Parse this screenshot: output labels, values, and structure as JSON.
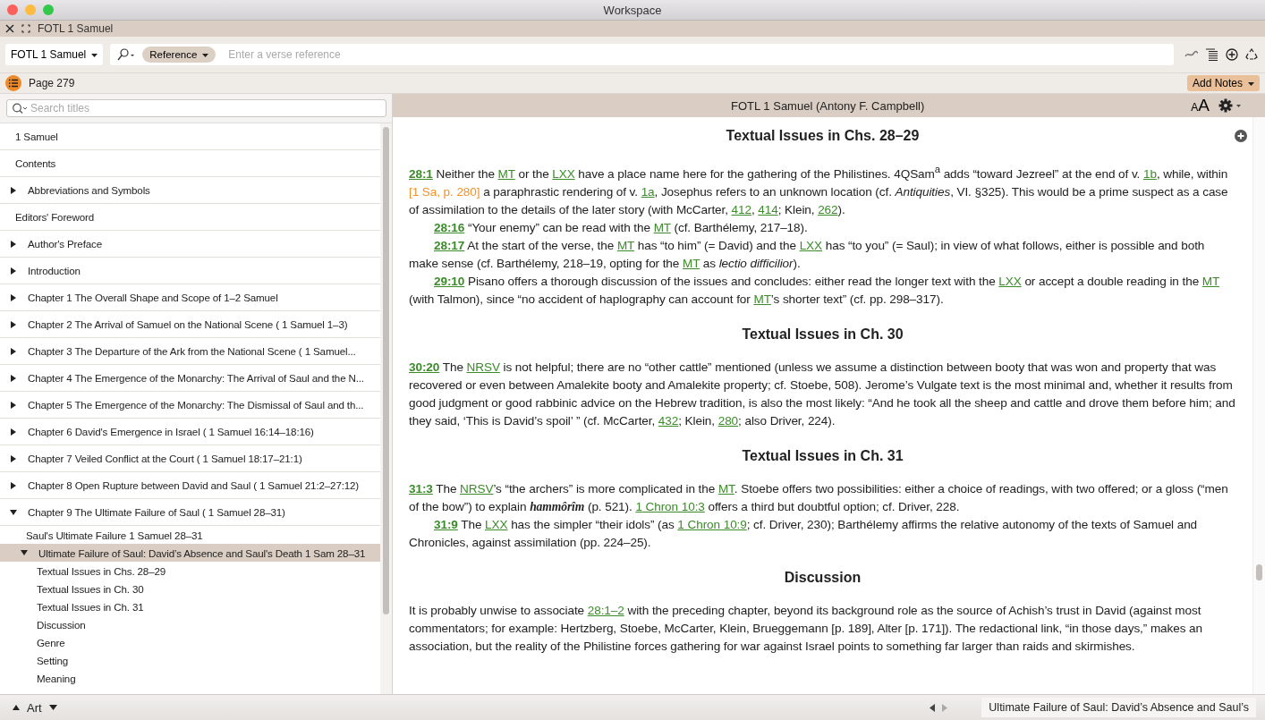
{
  "window": {
    "title": "Workspace"
  },
  "tab": {
    "title": "FOTL 1 Samuel"
  },
  "toolbar": {
    "resource": "FOTL 1 Samuel",
    "search_type": "Reference",
    "placeholder": "Enter a verse reference"
  },
  "page_bar": {
    "page": "Page 279",
    "add_notes": "Add Notes"
  },
  "sidebar": {
    "search_placeholder": "Search titles",
    "items": [
      {
        "title": "1 Samuel",
        "kind": "leaf",
        "selected": false
      },
      {
        "title": "Contents",
        "kind": "leaf",
        "selected": false
      },
      {
        "title": "Abbreviations and Symbols",
        "kind": "branch",
        "expanded": false,
        "selected": false
      },
      {
        "title": "Editors' Foreword",
        "kind": "leaf",
        "selected": false
      },
      {
        "title": "Author's Preface",
        "kind": "branch",
        "expanded": false,
        "selected": false
      },
      {
        "title": "Introduction",
        "kind": "branch",
        "expanded": false,
        "selected": false
      },
      {
        "title": "Chapter 1 The Overall Shape and Scope of 1–2 Samuel",
        "kind": "branch",
        "expanded": false,
        "selected": false
      },
      {
        "title": "Chapter 2 The Arrival of Samuel on the National Scene ( 1 Samuel 1–3)",
        "kind": "branch",
        "expanded": false,
        "selected": false
      },
      {
        "title": "Chapter 3 The Departure of the Ark from the National Scene ( 1 Samuel...",
        "kind": "branch",
        "expanded": false,
        "selected": false
      },
      {
        "title": "Chapter 4 The Emergence of the Monarchy: The Arrival of Saul and the N...",
        "kind": "branch",
        "expanded": false,
        "selected": false
      },
      {
        "title": "Chapter 5 The Emergence of the Monarchy: The Dismissal of Saul and th...",
        "kind": "branch",
        "expanded": false,
        "selected": false
      },
      {
        "title": "Chapter 6 David's Emergence in Israel ( 1 Samuel 16:14–18:16)",
        "kind": "branch",
        "expanded": false,
        "selected": false
      },
      {
        "title": "Chapter 7 Veiled Conflict at the Court ( 1 Samuel 18:17–21:1)",
        "kind": "branch",
        "expanded": false,
        "selected": false
      },
      {
        "title": "Chapter 8 Open Rupture between David and Saul ( 1 Samuel 21:2–27:12)",
        "kind": "branch",
        "expanded": false,
        "selected": false
      },
      {
        "title": "Chapter 9 The Ultimate Failure of Saul ( 1 Samuel 28–31)",
        "kind": "branch",
        "expanded": true,
        "selected": false,
        "children": [
          {
            "title": "Saul's Ultimate Failure 1 Samuel 28–31",
            "kind": "leaf",
            "selected": false
          },
          {
            "title": "Ultimate Failure of Saul: David’s Absence and Saul's Death 1 Sam 28–31",
            "kind": "branch",
            "expanded": true,
            "selected": true,
            "children": [
              {
                "title": "Textual Issues in Chs. 28–29",
                "kind": "leaf",
                "selected": false
              },
              {
                "title": "Textual Issues in Ch. 30",
                "kind": "leaf",
                "selected": false
              },
              {
                "title": "Textual Issues in Ch. 31",
                "kind": "leaf",
                "selected": false
              },
              {
                "title": "Discussion",
                "kind": "leaf",
                "selected": false
              },
              {
                "title": "Genre",
                "kind": "leaf",
                "selected": false
              },
              {
                "title": "Setting",
                "kind": "leaf",
                "selected": false
              },
              {
                "title": "Meaning",
                "kind": "leaf",
                "selected": false
              }
            ]
          }
        ]
      }
    ]
  },
  "reader": {
    "title": "FOTL 1 Samuel (Antony F. Campbell)",
    "font_button": "AA",
    "sections": [
      {
        "heading": "Textual Issues in Chs. 28–29",
        "paragraphs": [
          {
            "indent": false,
            "segments": [
              {
                "kind": "verse",
                "text": "28:1"
              },
              {
                "kind": "text",
                "text": " Neither the "
              },
              {
                "kind": "link",
                "text": "MT"
              },
              {
                "kind": "text",
                "text": " or the "
              },
              {
                "kind": "link",
                "text": "LXX"
              },
              {
                "kind": "text",
                "text": " have a place name here for the gathering of the Philistines. 4QSam$^{a}$ adds “toward Jezreel” at the end of v. "
              },
              {
                "kind": "link",
                "text": "1b"
              },
              {
                "kind": "text",
                "text": ", while, within "
              },
              {
                "kind": "cite",
                "text": "[1 Sa, p. 280]"
              },
              {
                "kind": "text",
                "text": " a paraphrastic rendering of v. "
              },
              {
                "kind": "link",
                "text": "1a"
              },
              {
                "kind": "text",
                "text": ", Josephus refers to an unknown location (cf. *Antiquities*, VI. §325). This would be a prime suspect as a case of assimilation to the details of the later story (with McCarter, "
              },
              {
                "kind": "link",
                "text": "412"
              },
              {
                "kind": "text",
                "text": ", "
              },
              {
                "kind": "link",
                "text": "414"
              },
              {
                "kind": "text",
                "text": "; Klein, "
              },
              {
                "kind": "link",
                "text": "262"
              },
              {
                "kind": "text",
                "text": ")."
              }
            ]
          },
          {
            "indent": true,
            "segments": [
              {
                "kind": "verse",
                "text": "28:16"
              },
              {
                "kind": "text",
                "text": " “Your enemy” can be read with the "
              },
              {
                "kind": "link",
                "text": "MT"
              },
              {
                "kind": "text",
                "text": " (cf. Barthélemy, 217–18)."
              }
            ]
          },
          {
            "indent": true,
            "segments": [
              {
                "kind": "verse",
                "text": "28:17"
              },
              {
                "kind": "text",
                "text": " At the start of the verse, the "
              },
              {
                "kind": "link",
                "text": "MT"
              },
              {
                "kind": "text",
                "text": " has “to him” (= David) and the "
              },
              {
                "kind": "link",
                "text": "LXX"
              },
              {
                "kind": "text",
                "text": " has “to you” (= Saul); in view of what follows, either is possible and both make sense (cf. Barthélemy, 218–19, opting for the "
              },
              {
                "kind": "link",
                "text": "MT"
              },
              {
                "kind": "text",
                "text": " as *lectio difficilior*)."
              }
            ]
          },
          {
            "indent": true,
            "segments": [
              {
                "kind": "verse",
                "text": "29:10"
              },
              {
                "kind": "text",
                "text": " Pisano offers a thorough discussion of the issues and concludes: either read the longer text with the "
              },
              {
                "kind": "link",
                "text": "LXX"
              },
              {
                "kind": "text",
                "text": " or accept a double reading in the "
              },
              {
                "kind": "link",
                "text": "MT"
              },
              {
                "kind": "text",
                "text": " (with Talmon), since “no accident of haplography can account for "
              },
              {
                "kind": "link",
                "text": "MT"
              },
              {
                "kind": "text",
                "text": "’s shorter text” (cf. pp. 298–317)."
              }
            ]
          }
        ]
      },
      {
        "heading": "Textual Issues in Ch. 30",
        "paragraphs": [
          {
            "indent": false,
            "segments": [
              {
                "kind": "verse",
                "text": "30:20"
              },
              {
                "kind": "text",
                "text": " The "
              },
              {
                "kind": "link",
                "text": "NRSV"
              },
              {
                "kind": "text",
                "text": " is not helpful; there are no “other cattle” mentioned (unless we assume a distinction between booty that was won and property that was recovered or even between Amalekite booty and Amalekite property; cf. Stoebe, 508). Jerome’s Vulgate text is the most minimal and, whether it results from good judgment or good rabbinic advice on the Hebrew tradition, is also the most likely: “And he took all the sheep and cattle and drove them before him; and they said, ‘This is David’s spoil’ ” (cf. McCarter, "
              },
              {
                "kind": "link",
                "text": "432"
              },
              {
                "kind": "text",
                "text": "; Klein, "
              },
              {
                "kind": "link",
                "text": "280"
              },
              {
                "kind": "text",
                "text": "; also Driver, 224)."
              }
            ]
          }
        ]
      },
      {
        "heading": "Textual Issues in Ch. 31",
        "paragraphs": [
          {
            "indent": false,
            "segments": [
              {
                "kind": "verse",
                "text": "31:3"
              },
              {
                "kind": "text",
                "text": " The "
              },
              {
                "kind": "link",
                "text": "NRSV"
              },
              {
                "kind": "text",
                "text": "’s “the archers” is more complicated in the "
              },
              {
                "kind": "link",
                "text": "MT"
              },
              {
                "kind": "text",
                "text": ". Stoebe offers two possibilities: either a choice of readings, with two offered; or a gloss (“men of the bow”) to explain "
              },
              {
                "kind": "term",
                "text": "hammôrîm"
              },
              {
                "kind": "text",
                "text": " (p. 521). "
              },
              {
                "kind": "link",
                "text": "1 Chron 10:3"
              },
              {
                "kind": "text",
                "text": " offers a third but doubtful option; cf. Driver, 228."
              }
            ]
          },
          {
            "indent": true,
            "segments": [
              {
                "kind": "verse",
                "text": "31:9"
              },
              {
                "kind": "text",
                "text": " The "
              },
              {
                "kind": "link",
                "text": "LXX"
              },
              {
                "kind": "text",
                "text": " has the simpler “their idols” (as "
              },
              {
                "kind": "link",
                "text": "1 Chron 10:9"
              },
              {
                "kind": "text",
                "text": "; cf. Driver, 230); Barthélemy affirms the relative autonomy of the texts of Samuel and Chronicles, against assimilation (pp. 224–25)."
              }
            ]
          }
        ]
      },
      {
        "heading": "Discussion",
        "paragraphs": [
          {
            "indent": false,
            "segments": [
              {
                "kind": "text",
                "text": "It is probably unwise to associate "
              },
              {
                "kind": "link",
                "text": "28:1–2"
              },
              {
                "kind": "text",
                "text": " with the preceding chapter, beyond its background role as the source of Achish’s trust in David (against most commentators; for example: Hertzberg, Stoebe, McCarter, Klein, Brueggemann [p. 189], Alter [p. 171]). The redactional link, “in those days,” makes an association, but the reality of the Philistine forces gathering for war against Israel points to something far larger than raids and skirmishes."
              }
            ]
          }
        ]
      }
    ]
  },
  "status_bar": {
    "layout": "Art",
    "location": "Ultimate Failure of Saul: David’s Absence and Saul’s"
  }
}
